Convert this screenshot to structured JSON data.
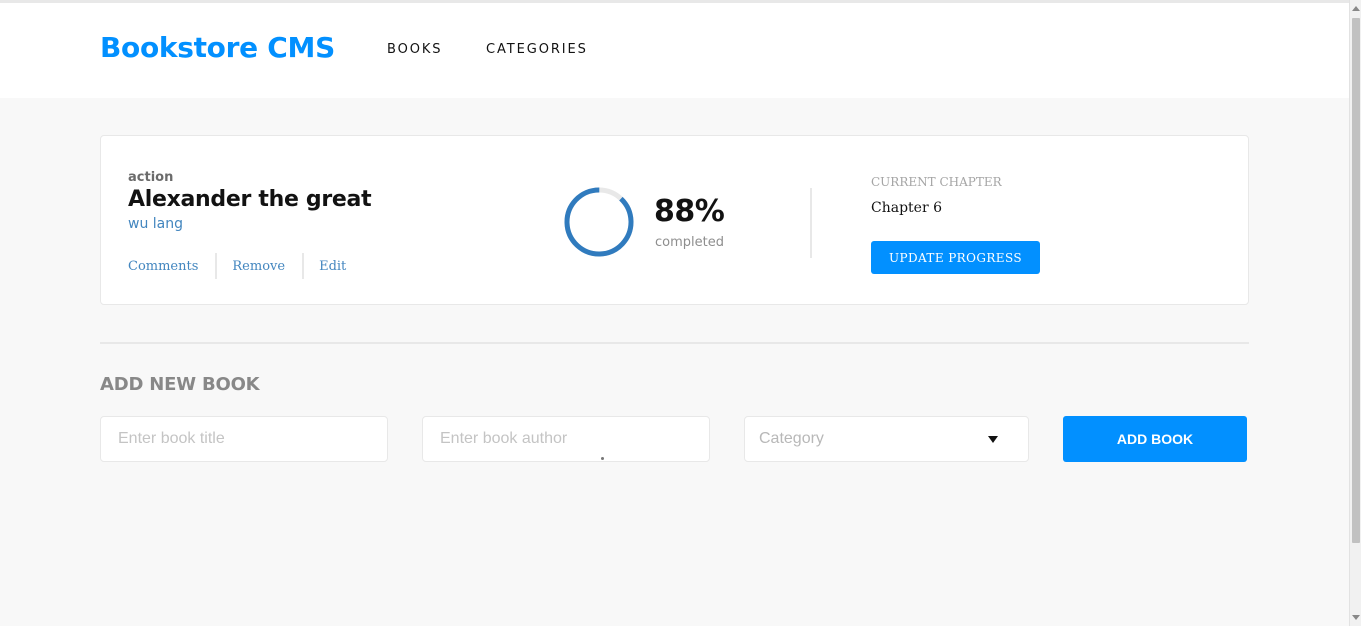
{
  "colors": {
    "brand": "#0290ff",
    "author_link": "#4386bf",
    "progress_stroke": "#307bbe",
    "progress_track": "#e8e8e8"
  },
  "header": {
    "logo": "Bookstore CMS",
    "nav": [
      {
        "label": "BOOKS"
      },
      {
        "label": "CATEGORIES"
      }
    ]
  },
  "book": {
    "genre": "action",
    "title": "Alexander the great",
    "author": "wu lang",
    "actions": [
      {
        "label": "Comments"
      },
      {
        "label": "Remove"
      },
      {
        "label": "Edit"
      }
    ],
    "progress": {
      "percent_value": 0.88,
      "percent_text": "88%",
      "completed_label": "completed"
    },
    "chapter": {
      "label": "CURRENT CHAPTER",
      "value": "Chapter 6",
      "update_button": "UPDATE PROGRESS"
    }
  },
  "add_form": {
    "title": "ADD NEW BOOK",
    "title_placeholder": "Enter book title",
    "author_placeholder": "Enter book author",
    "category_placeholder": "Category",
    "submit_label": "ADD BOOK"
  }
}
